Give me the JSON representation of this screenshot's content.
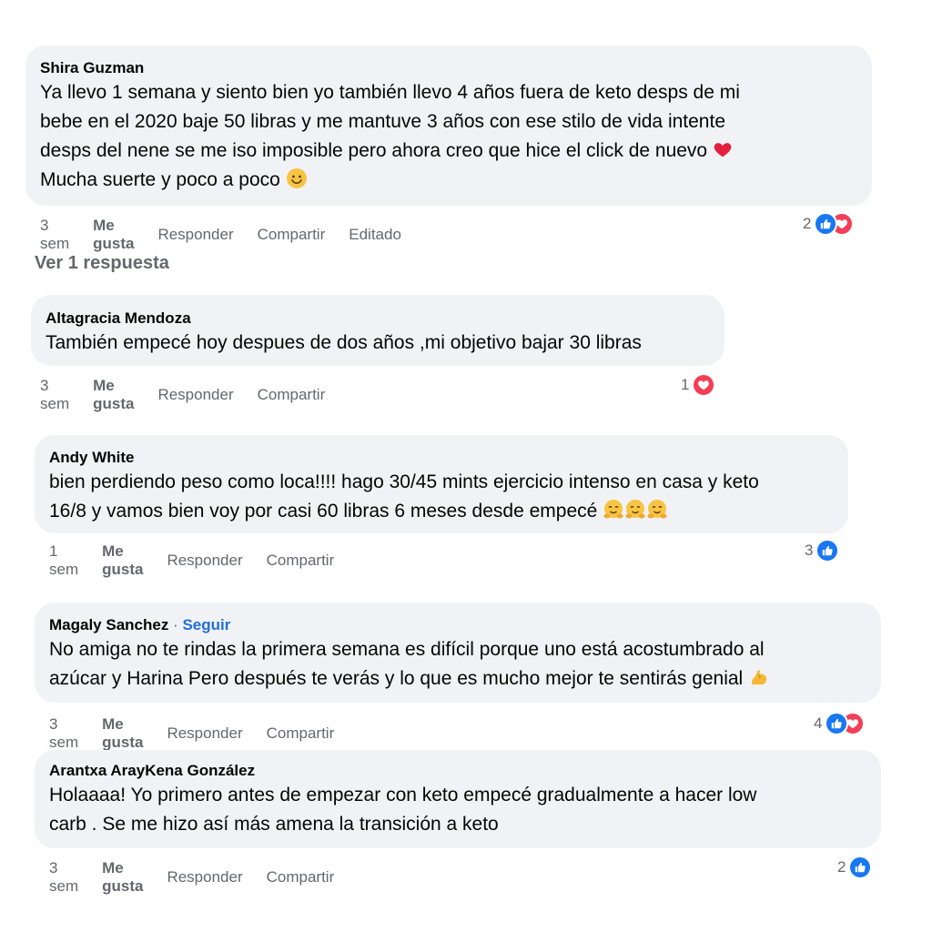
{
  "comments": [
    {
      "author": "Shira Guzman",
      "lines": [
        "Ya llevo 1 semana y siento bien yo también llevo 4 años fuera de keto desps de mi",
        "bebe en el 2020 baje 50 libras y me mantuve 3 años con ese stilo de vida intente",
        "desps del nene se me iso imposible pero ahora creo que hice el click de nuevo",
        "Mucha suerte y poco a poco"
      ],
      "time": "3 sem",
      "like": "Me gusta",
      "reply": "Responder",
      "share": "Compartir",
      "edited": "Editado",
      "reaction_count": "2"
    },
    {
      "author": "Altagracia Mendoza",
      "lines": [
        "También empecé hoy despues de dos años ,mi objetivo bajar 30 libras"
      ],
      "time": "3 sem",
      "like": "Me gusta",
      "reply": "Responder",
      "share": "Compartir",
      "reaction_count": "1"
    },
    {
      "author": "Andy White",
      "lines": [
        "bien perdiendo peso como loca!!!! hago 30/45 mints ejercicio intenso en casa y keto",
        "16/8 y vamos bien voy por casi 60 libras 6 meses desde empecé"
      ],
      "time": "1 sem",
      "like": "Me gusta",
      "reply": "Responder",
      "share": "Compartir",
      "reaction_count": "3"
    },
    {
      "author": "Magaly Sanchez",
      "follow": "Seguir",
      "lines": [
        "No amiga no te rindas la primera semana es difícil porque uno está acostumbrado al",
        "azúcar y Harina Pero después te verás y lo que es mucho mejor te sentirás genial"
      ],
      "time": "3 sem",
      "like": "Me gusta",
      "reply": "Responder",
      "share": "Compartir",
      "reaction_count": "4"
    },
    {
      "author": "Arantxa ArayKena González",
      "lines": [
        "Holaaaa! Yo primero antes de empezar con keto empecé gradualmente a hacer low",
        "carb . Se me hizo así más amena la transición a keto"
      ],
      "time": "3 sem",
      "like": "Me gusta",
      "reply": "Responder",
      "share": "Compartir",
      "reaction_count": "2"
    }
  ],
  "replies_link": "Ver 1 respuesta",
  "colors": {
    "bubble": "#f0f2f5",
    "like_blue": "#1877f2",
    "love_red": "#f33e58",
    "meta_gray": "#65676b",
    "follow_blue": "#216fdb"
  },
  "icons": [
    "heart-emoji",
    "smile-emoji",
    "hug-face-emoji",
    "flexed-biceps-emoji",
    "like-reaction-icon",
    "love-reaction-icon"
  ]
}
